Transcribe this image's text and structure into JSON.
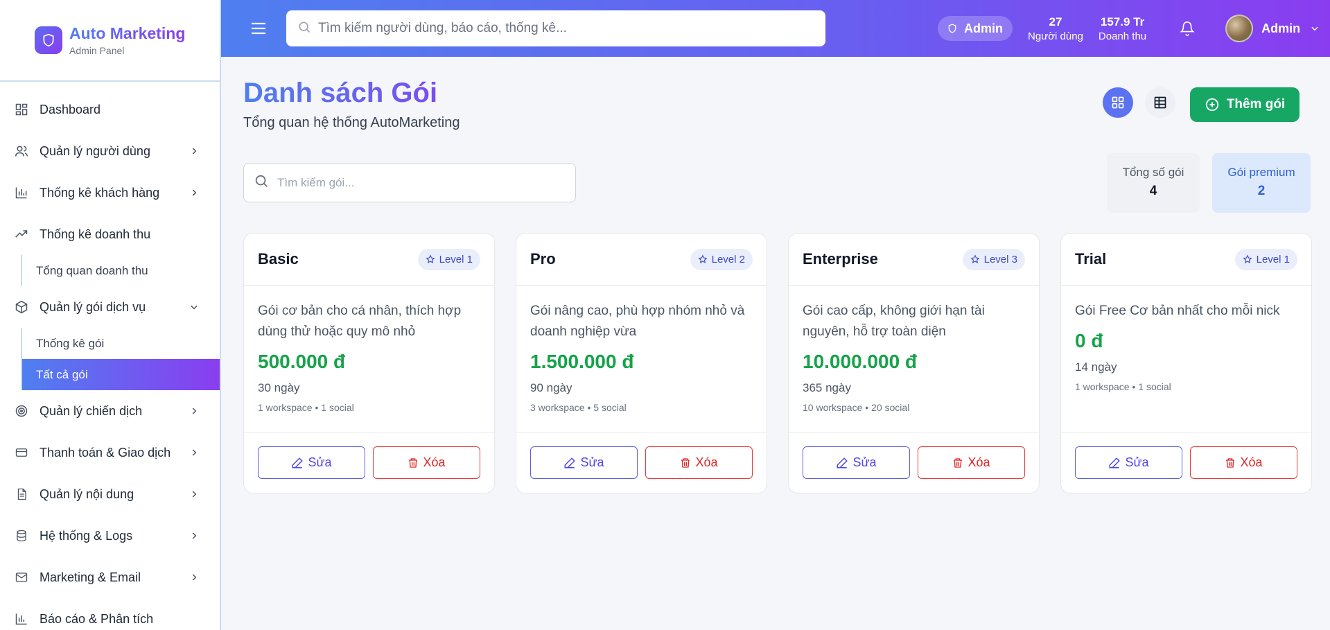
{
  "brand": {
    "title": "Auto Marketing",
    "subtitle": "Admin Panel"
  },
  "sidebar": {
    "items": [
      {
        "label": "Dashboard",
        "icon": "dashboard-icon"
      },
      {
        "label": "Quản lý người dùng",
        "icon": "users-icon"
      },
      {
        "label": "Thống kê khách hàng",
        "icon": "bar-chart-icon"
      },
      {
        "label": "Thống kê doanh thu",
        "icon": "trending-up-icon"
      },
      {
        "label": "Quản lý gói dịch vụ",
        "icon": "package-icon"
      },
      {
        "label": "Quản lý chiến dịch",
        "icon": "target-icon"
      },
      {
        "label": "Thanh toán & Giao dịch",
        "icon": "credit-card-icon"
      },
      {
        "label": "Quản lý nội dung",
        "icon": "document-icon"
      },
      {
        "label": "Hệ thống & Logs",
        "icon": "database-icon"
      },
      {
        "label": "Marketing & Email",
        "icon": "mail-icon"
      },
      {
        "label": "Báo cáo & Phân tích",
        "icon": "bar-chart-icon"
      }
    ],
    "revenue_sub": [
      "Tổng quan doanh thu"
    ],
    "package_sub": [
      "Thống kê gói",
      "Tất cả gói"
    ]
  },
  "header": {
    "search_placeholder": "Tìm kiếm người dùng, báo cáo, thống kê...",
    "role": "Admin",
    "users_value": "27",
    "users_label": "Người dùng",
    "revenue_value": "157.9 Tr",
    "revenue_label": "Doanh thu",
    "user_name": "Admin"
  },
  "page": {
    "title": "Danh sách Gói",
    "subtitle": "Tổng quan hệ thống AutoMarketing",
    "add_label": "Thêm gói",
    "search_placeholder": "Tìm kiếm gói...",
    "total_label": "Tổng số gói",
    "total_value": "4",
    "premium_label": "Gói premium",
    "premium_value": "2"
  },
  "packages": [
    {
      "name": "Basic",
      "level": "Level 1",
      "desc": "Gói cơ bản cho cá nhân, thích hợp dùng thử hoặc quy mô nhỏ",
      "price": "500.000 đ",
      "days": "30 ngày",
      "meta": "1 workspace • 1 social"
    },
    {
      "name": "Pro",
      "level": "Level 2",
      "desc": "Gói nâng cao, phù hợp nhóm nhỏ và doanh nghiệp vừa",
      "price": "1.500.000 đ",
      "days": "90 ngày",
      "meta": "3 workspace • 5 social"
    },
    {
      "name": "Enterprise",
      "level": "Level 3",
      "desc": "Gói cao cấp, không giới hạn tài nguyên, hỗ trợ toàn diện",
      "price": "10.000.000 đ",
      "days": "365 ngày",
      "meta": "10 workspace • 20 social"
    },
    {
      "name": "Trial",
      "level": "Level 1",
      "desc": "Gói Free Cơ bản nhất cho mỗi nick",
      "price": "0 đ",
      "days": "14 ngày",
      "meta": "1 workspace • 1 social"
    }
  ],
  "actions": {
    "edit_label": "Sửa",
    "delete_label": "Xóa"
  },
  "colors": {
    "accent_start": "#4f7ff0",
    "accent_end": "#8a3df0",
    "success": "#16a764",
    "price": "#16a34a",
    "danger": "#dc2626"
  }
}
